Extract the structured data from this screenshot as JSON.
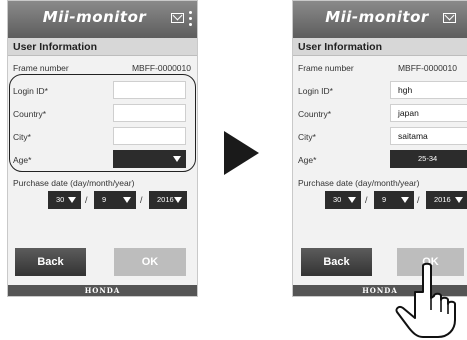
{
  "app": {
    "title": "Mii-monitor",
    "brand": "HONDA"
  },
  "left": {
    "header": "User Information",
    "frame_label": "Frame number",
    "frame_value": "MBFF-0000010",
    "login_label": "Login ID*",
    "login_value": "",
    "country_label": "Country*",
    "country_value": "",
    "city_label": "City*",
    "city_value": "",
    "age_label": "Age*",
    "age_value": "",
    "purchase_label": "Purchase date (day/month/year)",
    "day": "30",
    "month": "9",
    "year": "2016",
    "slash": "/",
    "back_label": "Back",
    "ok_label": "OK"
  },
  "right": {
    "header": "User Information",
    "frame_label": "Frame number",
    "frame_value": "MBFF-0000010",
    "login_label": "Login ID*",
    "login_value": "hgh",
    "country_label": "Country*",
    "country_value": "japan",
    "city_label": "City*",
    "city_value": "saitama",
    "age_label": "Age*",
    "age_value": "25-34",
    "purchase_label": "Purchase date (day/month/year)",
    "day": "30",
    "month": "9",
    "year": "2016",
    "slash": "/",
    "back_label": "Back",
    "ok_label": "OK"
  },
  "icons": {
    "mail": "envelope-icon",
    "menu": "kebab-menu-icon",
    "next": "arrow-right-icon",
    "hand": "pointing-hand-icon"
  },
  "colors": {
    "appbar": "#6e6e6e",
    "button_back": "#3f3f3f",
    "button_ok": "#bdbdbd",
    "select": "#2c2c2c"
  }
}
